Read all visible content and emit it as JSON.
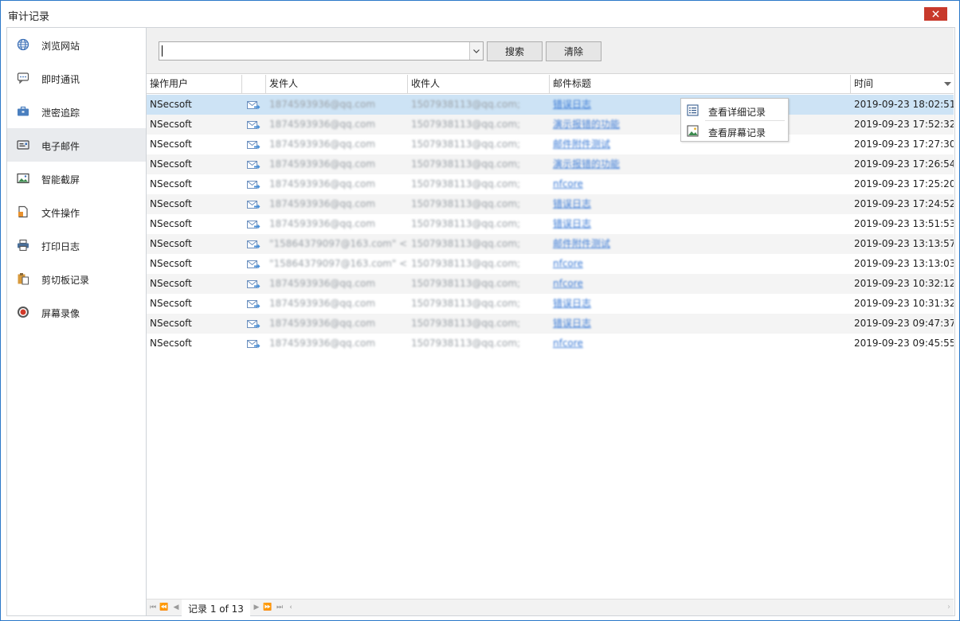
{
  "window": {
    "title": "审计记录"
  },
  "sidebar": {
    "items": [
      {
        "label": "浏览网站",
        "icon": "globe-icon"
      },
      {
        "label": "即时通讯",
        "icon": "chat-icon"
      },
      {
        "label": "泄密追踪",
        "icon": "briefcase-icon"
      },
      {
        "label": "电子邮件",
        "icon": "mail-card-icon",
        "active": true
      },
      {
        "label": "智能截屏",
        "icon": "picture-icon"
      },
      {
        "label": "文件操作",
        "icon": "file-icon"
      },
      {
        "label": "打印日志",
        "icon": "printer-icon"
      },
      {
        "label": "剪切板记录",
        "icon": "clipboard-icon"
      },
      {
        "label": "屏幕录像",
        "icon": "record-icon"
      }
    ]
  },
  "toolbar": {
    "search_value": "",
    "search_button": "搜索",
    "clear_button": "清除"
  },
  "grid": {
    "columns": [
      "操作用户",
      "",
      "发件人",
      "收件人",
      "邮件标题",
      "时间"
    ],
    "rows": [
      {
        "user": "NSecsoft",
        "from": "1874593936@qq.com",
        "to": "1507938113@qq.com;",
        "subject": "错误日志",
        "time": "2019-09-23 18:02:51"
      },
      {
        "user": "NSecsoft",
        "from": "1874593936@qq.com",
        "to": "1507938113@qq.com;",
        "subject": "演示报错的功能",
        "time": "2019-09-23 17:52:32"
      },
      {
        "user": "NSecsoft",
        "from": "1874593936@qq.com",
        "to": "1507938113@qq.com;",
        "subject": "邮件附件测试",
        "time": "2019-09-23 17:27:30"
      },
      {
        "user": "NSecsoft",
        "from": "1874593936@qq.com",
        "to": "1507938113@qq.com;",
        "subject": "演示报错的功能",
        "time": "2019-09-23 17:26:54"
      },
      {
        "user": "NSecsoft",
        "from": "1874593936@qq.com",
        "to": "1507938113@qq.com;",
        "subject": "nfcore",
        "time": "2019-09-23 17:25:20"
      },
      {
        "user": "NSecsoft",
        "from": "1874593936@qq.com",
        "to": "1507938113@qq.com;",
        "subject": "错误日志",
        "time": "2019-09-23 17:24:52"
      },
      {
        "user": "NSecsoft",
        "from": "1874593936@qq.com",
        "to": "1507938113@qq.com;",
        "subject": "错误日志",
        "time": "2019-09-23 13:51:53"
      },
      {
        "user": "NSecsoft",
        "from": "\"15864379097@163.com\" <...",
        "to": "1507938113@qq.com;",
        "subject": "邮件附件测试",
        "time": "2019-09-23 13:13:57"
      },
      {
        "user": "NSecsoft",
        "from": "\"15864379097@163.com\" <...",
        "to": "1507938113@qq.com;",
        "subject": "nfcore",
        "time": "2019-09-23 13:13:03"
      },
      {
        "user": "NSecsoft",
        "from": "1874593936@qq.com",
        "to": "1507938113@qq.com;",
        "subject": "nfcore",
        "time": "2019-09-23 10:32:12"
      },
      {
        "user": "NSecsoft",
        "from": "1874593936@qq.com",
        "to": "1507938113@qq.com;",
        "subject": "错误日志",
        "time": "2019-09-23 10:31:32"
      },
      {
        "user": "NSecsoft",
        "from": "1874593936@qq.com",
        "to": "1507938113@qq.com;",
        "subject": "错误日志",
        "time": "2019-09-23 09:47:37"
      },
      {
        "user": "NSecsoft",
        "from": "1874593936@qq.com",
        "to": "1507938113@qq.com;",
        "subject": "nfcore",
        "time": "2019-09-23 09:45:55"
      }
    ]
  },
  "context_menu": {
    "items": [
      {
        "label": "查看详细记录",
        "icon": "details-list-icon"
      },
      {
        "label": "查看屏幕记录",
        "icon": "screen-image-icon"
      }
    ]
  },
  "pager": {
    "text": "记录 1 of 13"
  },
  "colors": {
    "selected_row": "#cde3f5",
    "link": "#3b7bd6",
    "close_button": "#c8392b",
    "window_border": "#2b78c9"
  }
}
